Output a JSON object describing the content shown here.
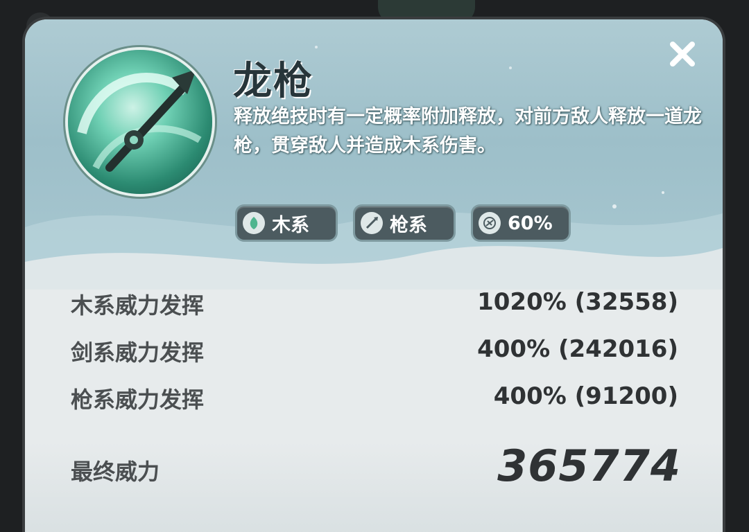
{
  "help_icon": "?",
  "skill": {
    "name": "龙枪",
    "description": "释放绝技时有一定概率附加释放，对前方敌人释放一道龙枪，贯穿敌人并造成木系伤害。",
    "icon": "dragon-spear-icon"
  },
  "tags": [
    {
      "icon": "wood-element-icon",
      "label": "木系"
    },
    {
      "icon": "spear-type-icon",
      "label": "枪系"
    },
    {
      "icon": "trigger-chance-icon",
      "label": "60%"
    }
  ],
  "stats": [
    {
      "label": "木系威力发挥",
      "value": "1020% (32558)"
    },
    {
      "label": "剑系威力发挥",
      "value": "400% (242016)"
    },
    {
      "label": "枪系威力发挥",
      "value": "400% (91200)"
    }
  ],
  "final": {
    "label": "最终威力",
    "value": "365774"
  },
  "colors": {
    "accent_teal": "#4fc3a1",
    "panel_top": "#a9c8d1",
    "panel_body": "#e7ebec",
    "tag_bg": "#4c5b60"
  }
}
